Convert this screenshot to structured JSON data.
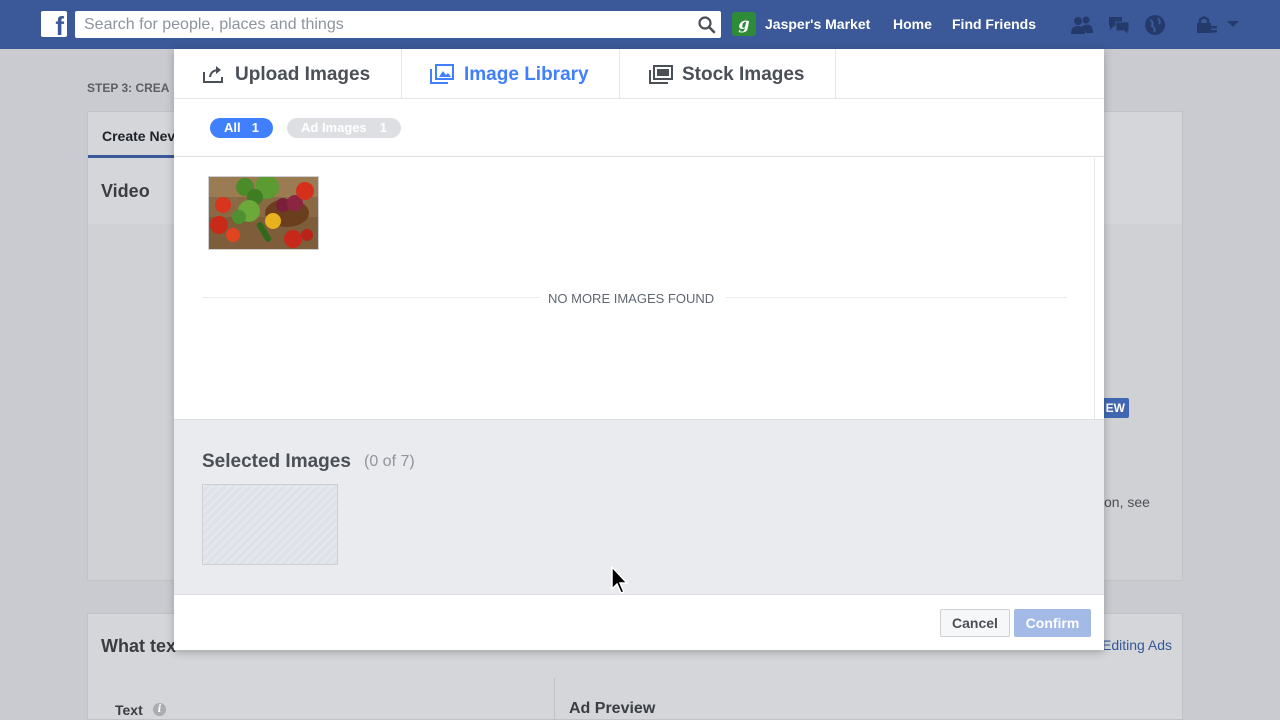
{
  "topbar": {
    "search_placeholder": "Search for people, places and things",
    "page_avatar_letter": "g",
    "page_name": "Jasper's Market",
    "home": "Home",
    "find_friends": "Find Friends",
    "icons": [
      "friend-requests-icon",
      "messages-icon",
      "notifications-globe-icon",
      "privacy-lock-icon",
      "account-menu-icon"
    ]
  },
  "background": {
    "step": "STEP 3: CREA",
    "tab": "Create Nev",
    "section_video": "Video",
    "preview_button": "EW",
    "see_text": "on, see",
    "section_text_title": "What tex",
    "editing_ads_link": "Editing Ads",
    "text_label": "Text",
    "info_icon_glyph": "i",
    "ad_preview": "Ad Preview"
  },
  "modal": {
    "tabs": [
      {
        "label": "Upload Images",
        "icon": "upload-icon"
      },
      {
        "label": "Image Library",
        "icon": "image-library-icon"
      },
      {
        "label": "Stock Images",
        "icon": "stock-images-icon"
      }
    ],
    "filters": [
      {
        "label": "All",
        "count": "1"
      },
      {
        "label": "Ad Images",
        "count": "1"
      }
    ],
    "library_images": [
      {
        "description": "vegetables"
      }
    ],
    "no_more": "NO MORE IMAGES FOUND",
    "selected_title": "Selected Images",
    "selected_count": "(0 of 7)",
    "cancel": "Cancel",
    "confirm": "Confirm"
  },
  "colors": {
    "facebook_blue": "#3b5998",
    "active_tab": "#4080ff",
    "confirm_disabled": "#a3b9e6"
  }
}
